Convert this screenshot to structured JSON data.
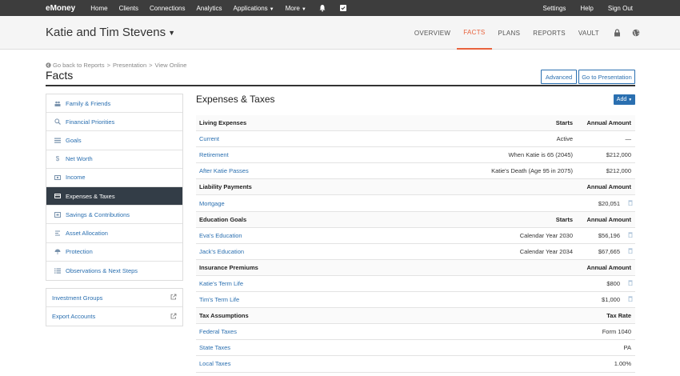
{
  "topnav": {
    "brand_prefix": "e",
    "brand_main": "Money",
    "items": [
      "Home",
      "Clients",
      "Connections",
      "Analytics",
      "Applications",
      "More"
    ],
    "right_items": [
      "Settings",
      "Help",
      "Sign Out"
    ]
  },
  "header": {
    "client_name": "Katie and Tim Stevens",
    "tabs": [
      "OVERVIEW",
      "FACTS",
      "PLANS",
      "REPORTS",
      "VAULT"
    ]
  },
  "breadcrumb": {
    "back": "Go back to Reports",
    "presentation": "Presentation",
    "view_online": "View Online"
  },
  "page": {
    "title": "Facts",
    "advanced_label": "Advanced",
    "go_presentation_label": "Go to Presentation"
  },
  "sidebar": {
    "items": [
      {
        "label": "Family & Friends",
        "icon": "people-icon"
      },
      {
        "label": "Financial Priorities",
        "icon": "search-icon"
      },
      {
        "label": "Goals",
        "icon": "list-icon"
      },
      {
        "label": "Net Worth",
        "icon": "dollar-icon"
      },
      {
        "label": "Income",
        "icon": "cash-icon"
      },
      {
        "label": "Expenses & Taxes",
        "icon": "card-icon"
      },
      {
        "label": "Savings & Contributions",
        "icon": "piggy-icon"
      },
      {
        "label": "Asset Allocation",
        "icon": "scale-icon"
      },
      {
        "label": "Protection",
        "icon": "umbrella-icon"
      },
      {
        "label": "Observations & Next Steps",
        "icon": "checklist-icon"
      }
    ],
    "extra": [
      "Investment Groups",
      "Export Accounts"
    ]
  },
  "main": {
    "section_title": "Expenses & Taxes",
    "add_label": "Add",
    "rows": [
      {
        "type": "head",
        "name": "Living Expenses",
        "starts": "Starts",
        "amount": "Annual Amount"
      },
      {
        "type": "item",
        "name": "Current",
        "starts": "Active",
        "amount": "—"
      },
      {
        "type": "item",
        "name": "Retirement",
        "starts": "When Katie is 65 (2045)",
        "amount": "$212,000"
      },
      {
        "type": "item",
        "name": "After Katie Passes",
        "starts": "Katie's Death (Age 95 in 2075)",
        "amount": "$212,000"
      },
      {
        "type": "head",
        "name": "Liability Payments",
        "starts": "",
        "amount": "Annual Amount"
      },
      {
        "type": "item",
        "name": "Mortgage",
        "starts": "",
        "amount": "$20,051",
        "del": true
      },
      {
        "type": "head",
        "name": "Education Goals",
        "starts": "Starts",
        "amount": "Annual Amount"
      },
      {
        "type": "item",
        "name": "Eva's Education",
        "starts": "Calendar Year 2030",
        "amount": "$56,196",
        "del": true
      },
      {
        "type": "item",
        "name": "Jack's Education",
        "starts": "Calendar Year 2034",
        "amount": "$67,665",
        "del": true
      },
      {
        "type": "head",
        "name": "Insurance Premiums",
        "starts": "",
        "amount": "Annual Amount"
      },
      {
        "type": "item",
        "name": "Katie's Term Life",
        "starts": "",
        "amount": "$800",
        "del": true
      },
      {
        "type": "item",
        "name": "Tim's Term Life",
        "starts": "",
        "amount": "$1,000",
        "del": true
      },
      {
        "type": "head",
        "name": "Tax Assumptions",
        "starts": "",
        "amount": "Tax Rate"
      },
      {
        "type": "item",
        "name": "Federal Taxes",
        "starts": "",
        "amount": "Form 1040"
      },
      {
        "type": "item",
        "name": "State Taxes",
        "starts": "",
        "amount": "PA"
      },
      {
        "type": "item",
        "name": "Local Taxes",
        "starts": "",
        "amount": "1.00%"
      }
    ]
  },
  "colors": {
    "accent": "#e8623c",
    "link": "#2a6fb0",
    "topbar": "#3d3d3d",
    "active_side": "#333d47"
  }
}
